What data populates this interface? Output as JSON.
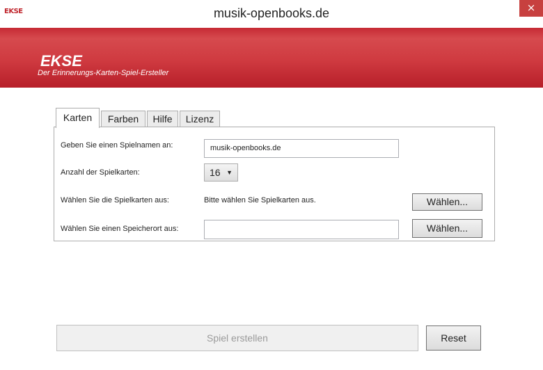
{
  "window": {
    "icon_text": "EKSE",
    "title": "musik-openbooks.de",
    "close_glyph": "×"
  },
  "banner": {
    "title": "EKSE",
    "subtitle": "Der Erinnerungs-Karten-Spiel-Ersteller",
    "color": "#c62a34"
  },
  "tabs": [
    {
      "label": "Karten",
      "active": true
    },
    {
      "label": "Farben",
      "active": false
    },
    {
      "label": "Hilfe",
      "active": false
    },
    {
      "label": "Lizenz",
      "active": false
    }
  ],
  "form": {
    "name_label": "Geben Sie einen Spielnamen an:",
    "name_value": "musik-openbooks.de",
    "count_label": "Anzahl der Spielkarten:",
    "count_value": "16",
    "cards_label": "Wählen Sie die Spielkarten aus:",
    "cards_status": "Bitte wählen Sie Spielkarten aus.",
    "cards_button": "Wählen...",
    "location_label": "Wählen Sie einen Speicherort aus:",
    "location_value": "",
    "location_button": "Wählen..."
  },
  "footer": {
    "create_label": "Spiel erstellen",
    "create_enabled": false,
    "reset_label": "Reset"
  }
}
